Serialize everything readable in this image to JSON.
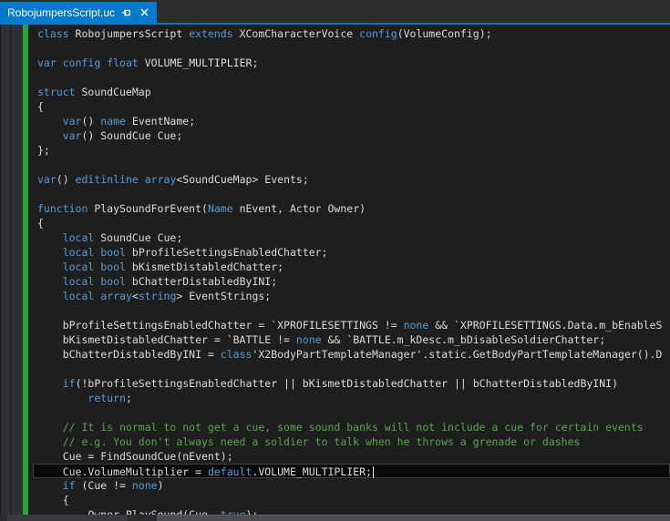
{
  "tab": {
    "title": "RobojumpersScript.uc",
    "icons": [
      "pin-icon",
      "close-icon"
    ]
  },
  "colors": {
    "accent": "#007acc",
    "tabbar_bg": "#2d2d30",
    "tab_text": "#ffffff",
    "editor_bg": "#1e1e1e",
    "margin_bg": "#2f2f34",
    "margin_seam": "#26262a",
    "change_bar": "#2ea52e",
    "text": "#dcdcdc",
    "keyword": "#569cd6",
    "comment": "#57a64a",
    "current_line_bg": "#0a0a0a",
    "current_line_border": "#3f3f44",
    "cursor": "#e8e8e8",
    "scrollbar_track": "#2b2b2e",
    "scrollbar_thumb": "#4d4d52"
  },
  "editor": {
    "language": "UnrealScript",
    "current_line_index": 30,
    "cursor_visible": true,
    "lines": [
      [
        [
          "k",
          "class"
        ],
        [
          "t",
          " RobojumpersScript "
        ],
        [
          "k",
          "extends"
        ],
        [
          "t",
          " XComCharacterVoice "
        ],
        [
          "k",
          "config"
        ],
        [
          "t",
          "(VolumeConfig);"
        ]
      ],
      [],
      [
        [
          "k",
          "var"
        ],
        [
          "t",
          " "
        ],
        [
          "k",
          "config"
        ],
        [
          "t",
          " "
        ],
        [
          "k",
          "float"
        ],
        [
          "t",
          " VOLUME_MULTIPLIER;"
        ]
      ],
      [],
      [
        [
          "k",
          "struct"
        ],
        [
          "t",
          " SoundCueMap"
        ]
      ],
      [
        [
          "t",
          "{"
        ]
      ],
      [
        [
          "t",
          "    "
        ],
        [
          "k",
          "var"
        ],
        [
          "t",
          "() "
        ],
        [
          "k",
          "name"
        ],
        [
          "t",
          " EventName;"
        ]
      ],
      [
        [
          "t",
          "    "
        ],
        [
          "k",
          "var"
        ],
        [
          "t",
          "() SoundCue Cue;"
        ]
      ],
      [
        [
          "t",
          "};"
        ]
      ],
      [],
      [
        [
          "k",
          "var"
        ],
        [
          "t",
          "() "
        ],
        [
          "k",
          "editinline"
        ],
        [
          "t",
          " "
        ],
        [
          "k",
          "array"
        ],
        [
          "t",
          "<SoundCueMap> Events;"
        ]
      ],
      [],
      [
        [
          "k",
          "function"
        ],
        [
          "t",
          " PlaySoundForEvent("
        ],
        [
          "k",
          "Name"
        ],
        [
          "t",
          " nEvent, Actor Owner)"
        ]
      ],
      [
        [
          "t",
          "{"
        ]
      ],
      [
        [
          "t",
          "    "
        ],
        [
          "k",
          "local"
        ],
        [
          "t",
          " SoundCue Cue;"
        ]
      ],
      [
        [
          "t",
          "    "
        ],
        [
          "k",
          "local"
        ],
        [
          "t",
          " "
        ],
        [
          "k",
          "bool"
        ],
        [
          "t",
          " bProfileSettingsEnabledChatter;"
        ]
      ],
      [
        [
          "t",
          "    "
        ],
        [
          "k",
          "local"
        ],
        [
          "t",
          " "
        ],
        [
          "k",
          "bool"
        ],
        [
          "t",
          " bKismetDistabledChatter;"
        ]
      ],
      [
        [
          "t",
          "    "
        ],
        [
          "k",
          "local"
        ],
        [
          "t",
          " "
        ],
        [
          "k",
          "bool"
        ],
        [
          "t",
          " bChatterDistabledByINI;"
        ]
      ],
      [
        [
          "t",
          "    "
        ],
        [
          "k",
          "local"
        ],
        [
          "t",
          " "
        ],
        [
          "k",
          "array"
        ],
        [
          "t",
          "<"
        ],
        [
          "k",
          "string"
        ],
        [
          "t",
          "> EventStrings;"
        ]
      ],
      [],
      [
        [
          "t",
          "    bProfileSettingsEnabledChatter = `XPROFILESETTINGS != "
        ],
        [
          "k",
          "none"
        ],
        [
          "t",
          " && `XPROFILESETTINGS.Data.m_bEnableS"
        ]
      ],
      [
        [
          "t",
          "    bKismetDistabledChatter = `BATTLE != "
        ],
        [
          "k",
          "none"
        ],
        [
          "t",
          " && `BATTLE.m_kDesc.m_bDisableSoldierChatter;"
        ]
      ],
      [
        [
          "t",
          "    bChatterDistabledByINI = "
        ],
        [
          "k",
          "class"
        ],
        [
          "t",
          "'X2BodyPartTemplateManager'.static.GetBodyPartTemplateManager().D"
        ]
      ],
      [],
      [
        [
          "t",
          "    "
        ],
        [
          "k",
          "if"
        ],
        [
          "t",
          "(!bProfileSettingsEnabledChatter || bKismetDistabledChatter || bChatterDistabledByINI)"
        ]
      ],
      [
        [
          "t",
          "        "
        ],
        [
          "k",
          "return"
        ],
        [
          "t",
          ";"
        ]
      ],
      [],
      [
        [
          "c",
          "    // It is normal to not get a cue, some sound banks will not include a cue for certain events"
        ]
      ],
      [
        [
          "c",
          "    // e.g. You don't always need a soldier to talk when he throws a grenade or dashes"
        ]
      ],
      [
        [
          "t",
          "    Cue = FindSoundCue(nEvent);"
        ]
      ],
      [
        [
          "t",
          "    Cue.VolumeMultiplier = "
        ],
        [
          "k",
          "default"
        ],
        [
          "t",
          ".VOLUME_MULTIPLIER;"
        ]
      ],
      [
        [
          "t",
          "    "
        ],
        [
          "k",
          "if"
        ],
        [
          "t",
          " (Cue != "
        ],
        [
          "k",
          "none"
        ],
        [
          "t",
          ")"
        ]
      ],
      [
        [
          "t",
          "    {"
        ]
      ],
      [
        [
          "t",
          "        Owner.PlaySound(Cue, "
        ],
        [
          "k",
          "true"
        ],
        [
          "t",
          ");"
        ]
      ]
    ]
  }
}
